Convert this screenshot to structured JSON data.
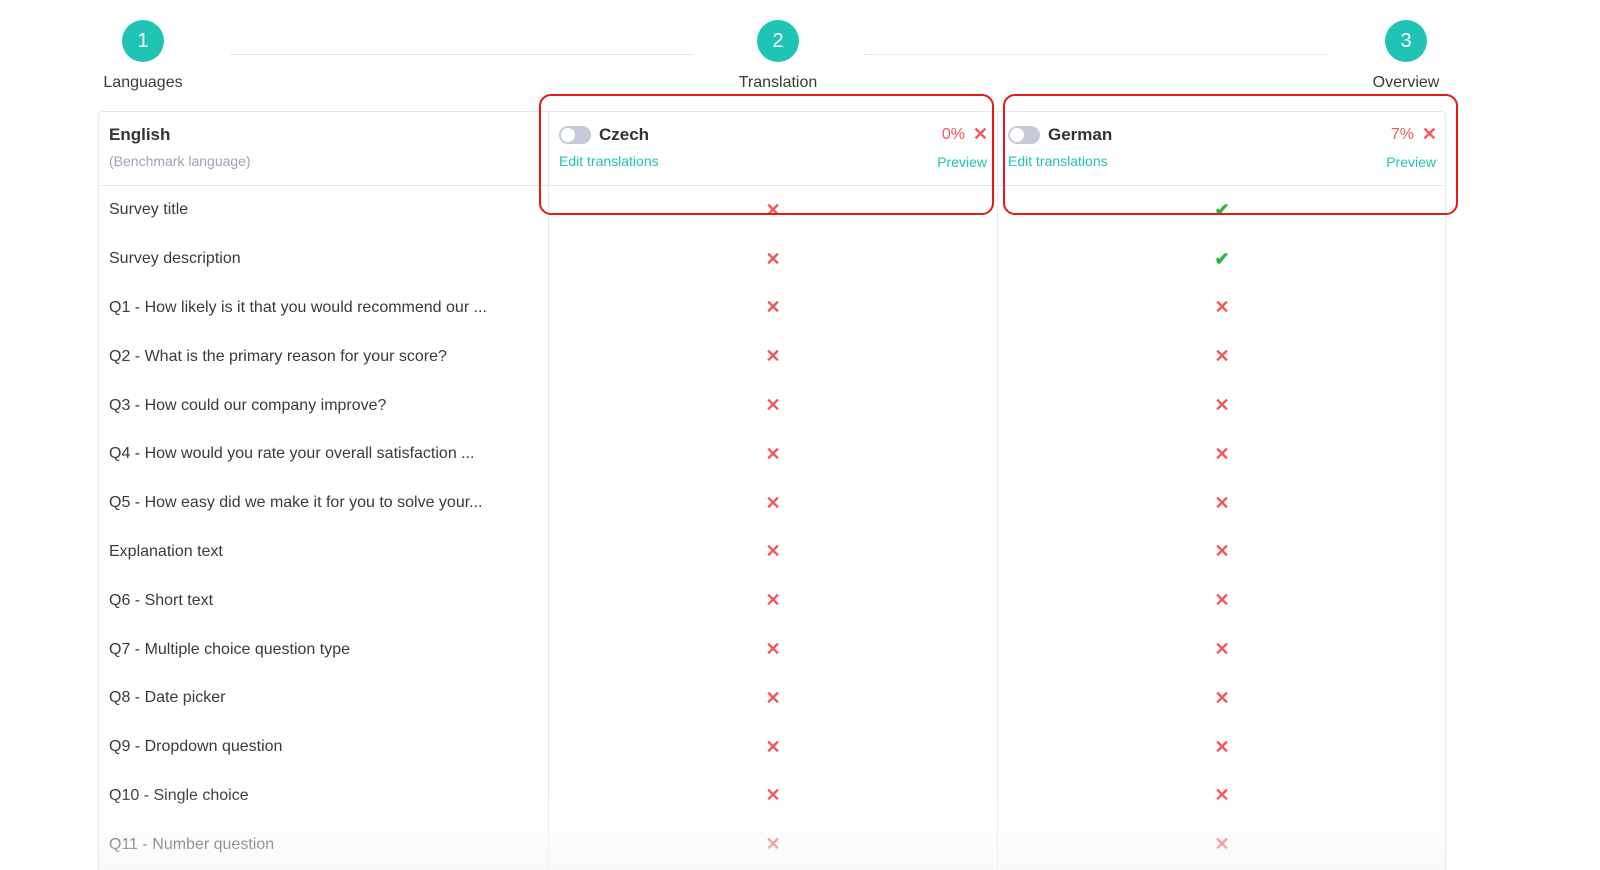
{
  "stepper": {
    "steps": [
      {
        "number": "1",
        "label": "Languages"
      },
      {
        "number": "2",
        "label": "Translation"
      },
      {
        "number": "3",
        "label": "Overview"
      }
    ]
  },
  "benchmark": {
    "name": "English",
    "subtitle": "(Benchmark language)"
  },
  "languages": [
    {
      "name": "Czech",
      "percent": "0%",
      "remove_icon": "close-icon",
      "edit_label": "Edit translations",
      "preview_label": "Preview",
      "enabled": false
    },
    {
      "name": "German",
      "percent": "7%",
      "remove_icon": "close-icon",
      "edit_label": "Edit translations",
      "preview_label": "Preview",
      "enabled": false
    }
  ],
  "status_glyphs": {
    "missing": "✕",
    "done": "✔"
  },
  "colors": {
    "accent": "#1fc4b4",
    "error": "#f0595b",
    "success": "#22b83a",
    "highlight": "#e81818"
  },
  "rows": [
    {
      "label": "Survey title",
      "czech": "missing",
      "german": "done"
    },
    {
      "label": "Survey description",
      "czech": "missing",
      "german": "done"
    },
    {
      "label": "Q1 - How likely is it that you would recommend our ...",
      "czech": "missing",
      "german": "missing"
    },
    {
      "label": "Q2 - What is the primary reason for your score?",
      "czech": "missing",
      "german": "missing"
    },
    {
      "label": "Q3 - How could our company improve?",
      "czech": "missing",
      "german": "missing"
    },
    {
      "label": "Q4 - How would you rate your overall satisfaction ...",
      "czech": "missing",
      "german": "missing"
    },
    {
      "label": "Q5 - How easy did we make it for you to solve your...",
      "czech": "missing",
      "german": "missing"
    },
    {
      "label": "Explanation text",
      "czech": "missing",
      "german": "missing"
    },
    {
      "label": "Q6 - Short text",
      "czech": "missing",
      "german": "missing"
    },
    {
      "label": "Q7 - Multiple choice question type",
      "czech": "missing",
      "german": "missing"
    },
    {
      "label": "Q8 - Date picker",
      "czech": "missing",
      "german": "missing"
    },
    {
      "label": "Q9 - Dropdown question",
      "czech": "missing",
      "german": "missing"
    },
    {
      "label": "Q10 - Single choice",
      "czech": "missing",
      "german": "missing"
    },
    {
      "label": "Q11 - Number question",
      "czech": "missing",
      "german": "missing"
    }
  ]
}
